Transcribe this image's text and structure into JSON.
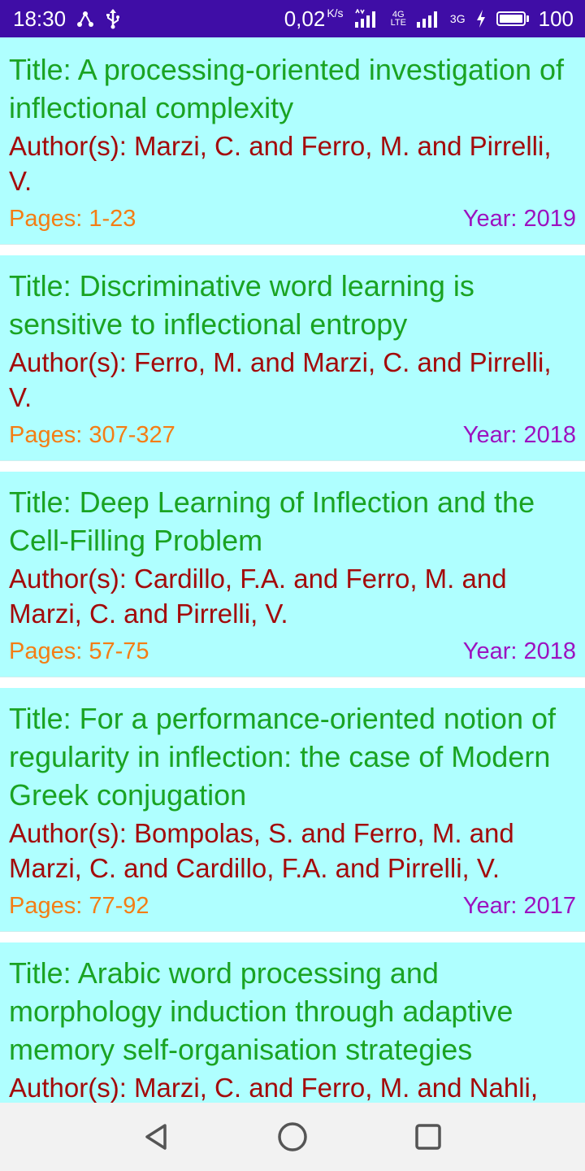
{
  "status_bar": {
    "time": "18:30",
    "speed_value": "0,02",
    "speed_unit": "K/s",
    "network_4g": "4G",
    "network_lte": "LTE",
    "network_3g": "3G",
    "battery_level": "100",
    "icons": [
      "usb-tether-icon",
      "usb-icon",
      "signal-icon",
      "signal-icon",
      "charging-icon",
      "battery-icon"
    ]
  },
  "publications": [
    {
      "title": "Title: A processing-oriented investigation of inflectional complexity",
      "authors": "Author(s): Marzi, C. and Ferro, M. and Pirrelli, V.",
      "pages": "Pages: 1-23",
      "year": "Year: 2019"
    },
    {
      "title": "Title: Discriminative word learning is sensitive to inflectional entropy",
      "authors": "Author(s): Ferro, M. and Marzi, C. and Pirrelli, V.",
      "pages": "Pages: 307-327",
      "year": "Year: 2018"
    },
    {
      "title": "Title: Deep Learning of Inflection and the Cell-Filling Problem",
      "authors": "Author(s): Cardillo, F.A. and Ferro, M. and Marzi, C. and Pirrelli, V.",
      "pages": "Pages: 57-75",
      "year": "Year: 2018"
    },
    {
      "title": "Title: For a performance-oriented notion of regularity in inflection: the case of Modern Greek conjugation",
      "authors": "Author(s): Bompolas, S. and Ferro, M. and Marzi, C. and Cardillo, F.A. and Pirrelli, V.",
      "pages": "Pages: 77-92",
      "year": "Year: 2017"
    },
    {
      "title": "Title: Arabic word processing and morphology induction through adaptive memory self-organisation strategies",
      "authors": "Author(s): Marzi, C. and Ferro, M. and Nahli,",
      "pages": "",
      "year": ""
    }
  ],
  "colors": {
    "status_bar": "#3F0DA6",
    "card_background": "#AFFFFF",
    "title": "#1AA323",
    "authors": "#A30B0B",
    "pages": "#F47D14",
    "year": "#9C12C0",
    "nav_bar": "#F2F2F2"
  },
  "nav_bar": {
    "icons": [
      "back-icon",
      "home-icon",
      "recents-icon"
    ]
  }
}
